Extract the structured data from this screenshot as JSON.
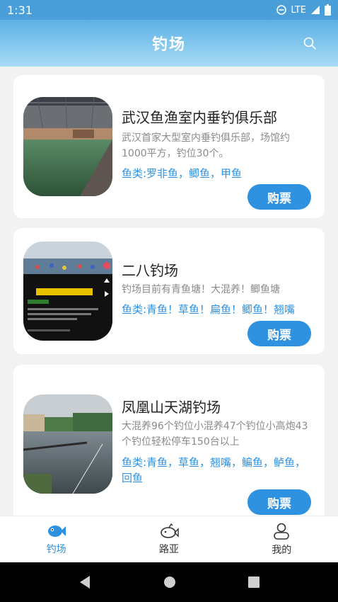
{
  "status_bar": {
    "time": "1:31",
    "network": "LTE"
  },
  "header": {
    "title": "钓场"
  },
  "venues": [
    {
      "name": "武汉鱼渔室内垂钓俱乐部",
      "description": "武汉首家大型室内垂钓俱乐部，场馆约1000平方，钓位30个。",
      "fish": "鱼类:罗非鱼，鲫鱼，甲鱼",
      "buy_label": "购票"
    },
    {
      "name": "二八钓场",
      "description": "钓场目前有青鱼塘！大混养！鲫鱼塘",
      "fish": "鱼类:青鱼！草鱼！扁鱼！鲫鱼！翘嘴",
      "buy_label": "购票"
    },
    {
      "name": "凤凰山天湖钓场",
      "description": "大混养96个钓位小混养47个钓位小高炮43个钓位轻松停车150台以上",
      "fish": "鱼类:青鱼，草鱼，翘嘴，鳊鱼，鲈鱼，回鱼",
      "buy_label": "购票"
    }
  ],
  "tabs": [
    {
      "label": "钓场",
      "icon": "fish-icon",
      "active": true
    },
    {
      "label": "路亚",
      "icon": "lure-icon",
      "active": false
    },
    {
      "label": "我的",
      "icon": "user-icon",
      "active": false
    }
  ],
  "colors": {
    "accent": "#2e92e0",
    "header_top": "#5db0e6",
    "header_bottom": "#a8dcf5"
  }
}
